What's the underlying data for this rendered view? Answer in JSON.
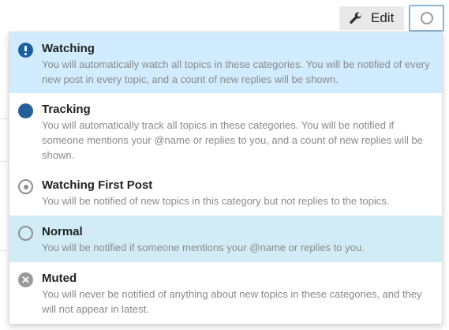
{
  "toolbar": {
    "edit_label": "Edit",
    "edit_icon": "wrench-icon",
    "notification_icon": "circle-outline-icon"
  },
  "notification_menu": {
    "items": [
      {
        "title": "Watching",
        "description": "You will automatically watch all topics in these categories. You will be notified of every new post in every topic, and a count of new replies will be shown.",
        "icon": "exclamation-circle-icon"
      },
      {
        "title": "Tracking",
        "description": "You will automatically track all topics in these categories. You will be notified if someone mentions your @name or replies to you, and a count of new replies will be shown.",
        "icon": "filled-circle-icon"
      },
      {
        "title": "Watching First Post",
        "description": "You will be notified of new topics in this category but not replies to the topics.",
        "icon": "dot-circle-icon"
      },
      {
        "title": "Normal",
        "description": "You will be notified if someone mentions your @name or replies to you.",
        "icon": "circle-outline-icon"
      },
      {
        "title": "Muted",
        "description": "You will never be notified of anything about new topics in these categories, and they will not appear in latest.",
        "icon": "times-circle-icon"
      }
    ]
  },
  "colors": {
    "highlight_watching": "#d1ecff",
    "highlight_normal": "#d1ecf7",
    "tracking_blue": "#255f9a"
  }
}
